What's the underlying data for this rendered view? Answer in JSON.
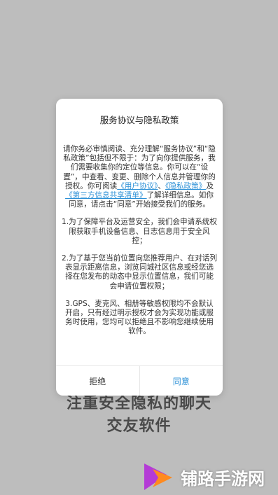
{
  "background": {
    "slogan_line1": "注重安全隐私的聊天",
    "slogan_line2": "交友软件"
  },
  "dialog": {
    "title": "服务协议与隐私政策",
    "intro_before_links": "请你务必审慎阅读、充分理解“服务协议”和“隐私政策”包括但不限于：为了向你提供服务，我们需要收集你的定位等信息。你可以在“设置”，中查看、变更、删除个人信息并管理你的授权。你可阅读",
    "link_user_agreement": "《用户协议》",
    "sep1": "、",
    "link_privacy_policy": "《隐私政策》",
    "sep2": "及",
    "link_third_party": "《第三方信息共享清单》",
    "intro_after_links": "了解详细信息。如你同意，请点击“同意”开始接受我们的服务。",
    "clause1": "1.为了保障平台及运营安全，我们会申请系统权限获取手机设备信息、日志信息用于安全风控；",
    "clause2": "2.为了基于您当前位置向您推荐用户、在对话列表显示距离信息，浏览同城社区信息或经您选择在您发布的动态中显示位置信息，我们可能会申请位置权限；",
    "clause3": "3.GPS、麦克风、相册等敏感权限均不会默认开启，只有经过明示授权才会为实现功能或服务时使用，您均可以拒绝且不影响您继续使用软件。",
    "reject_label": "拒绝",
    "agree_label": "同意"
  },
  "watermark": {
    "text": "铺路手游网",
    "icon": "pulu-logo-icon"
  }
}
